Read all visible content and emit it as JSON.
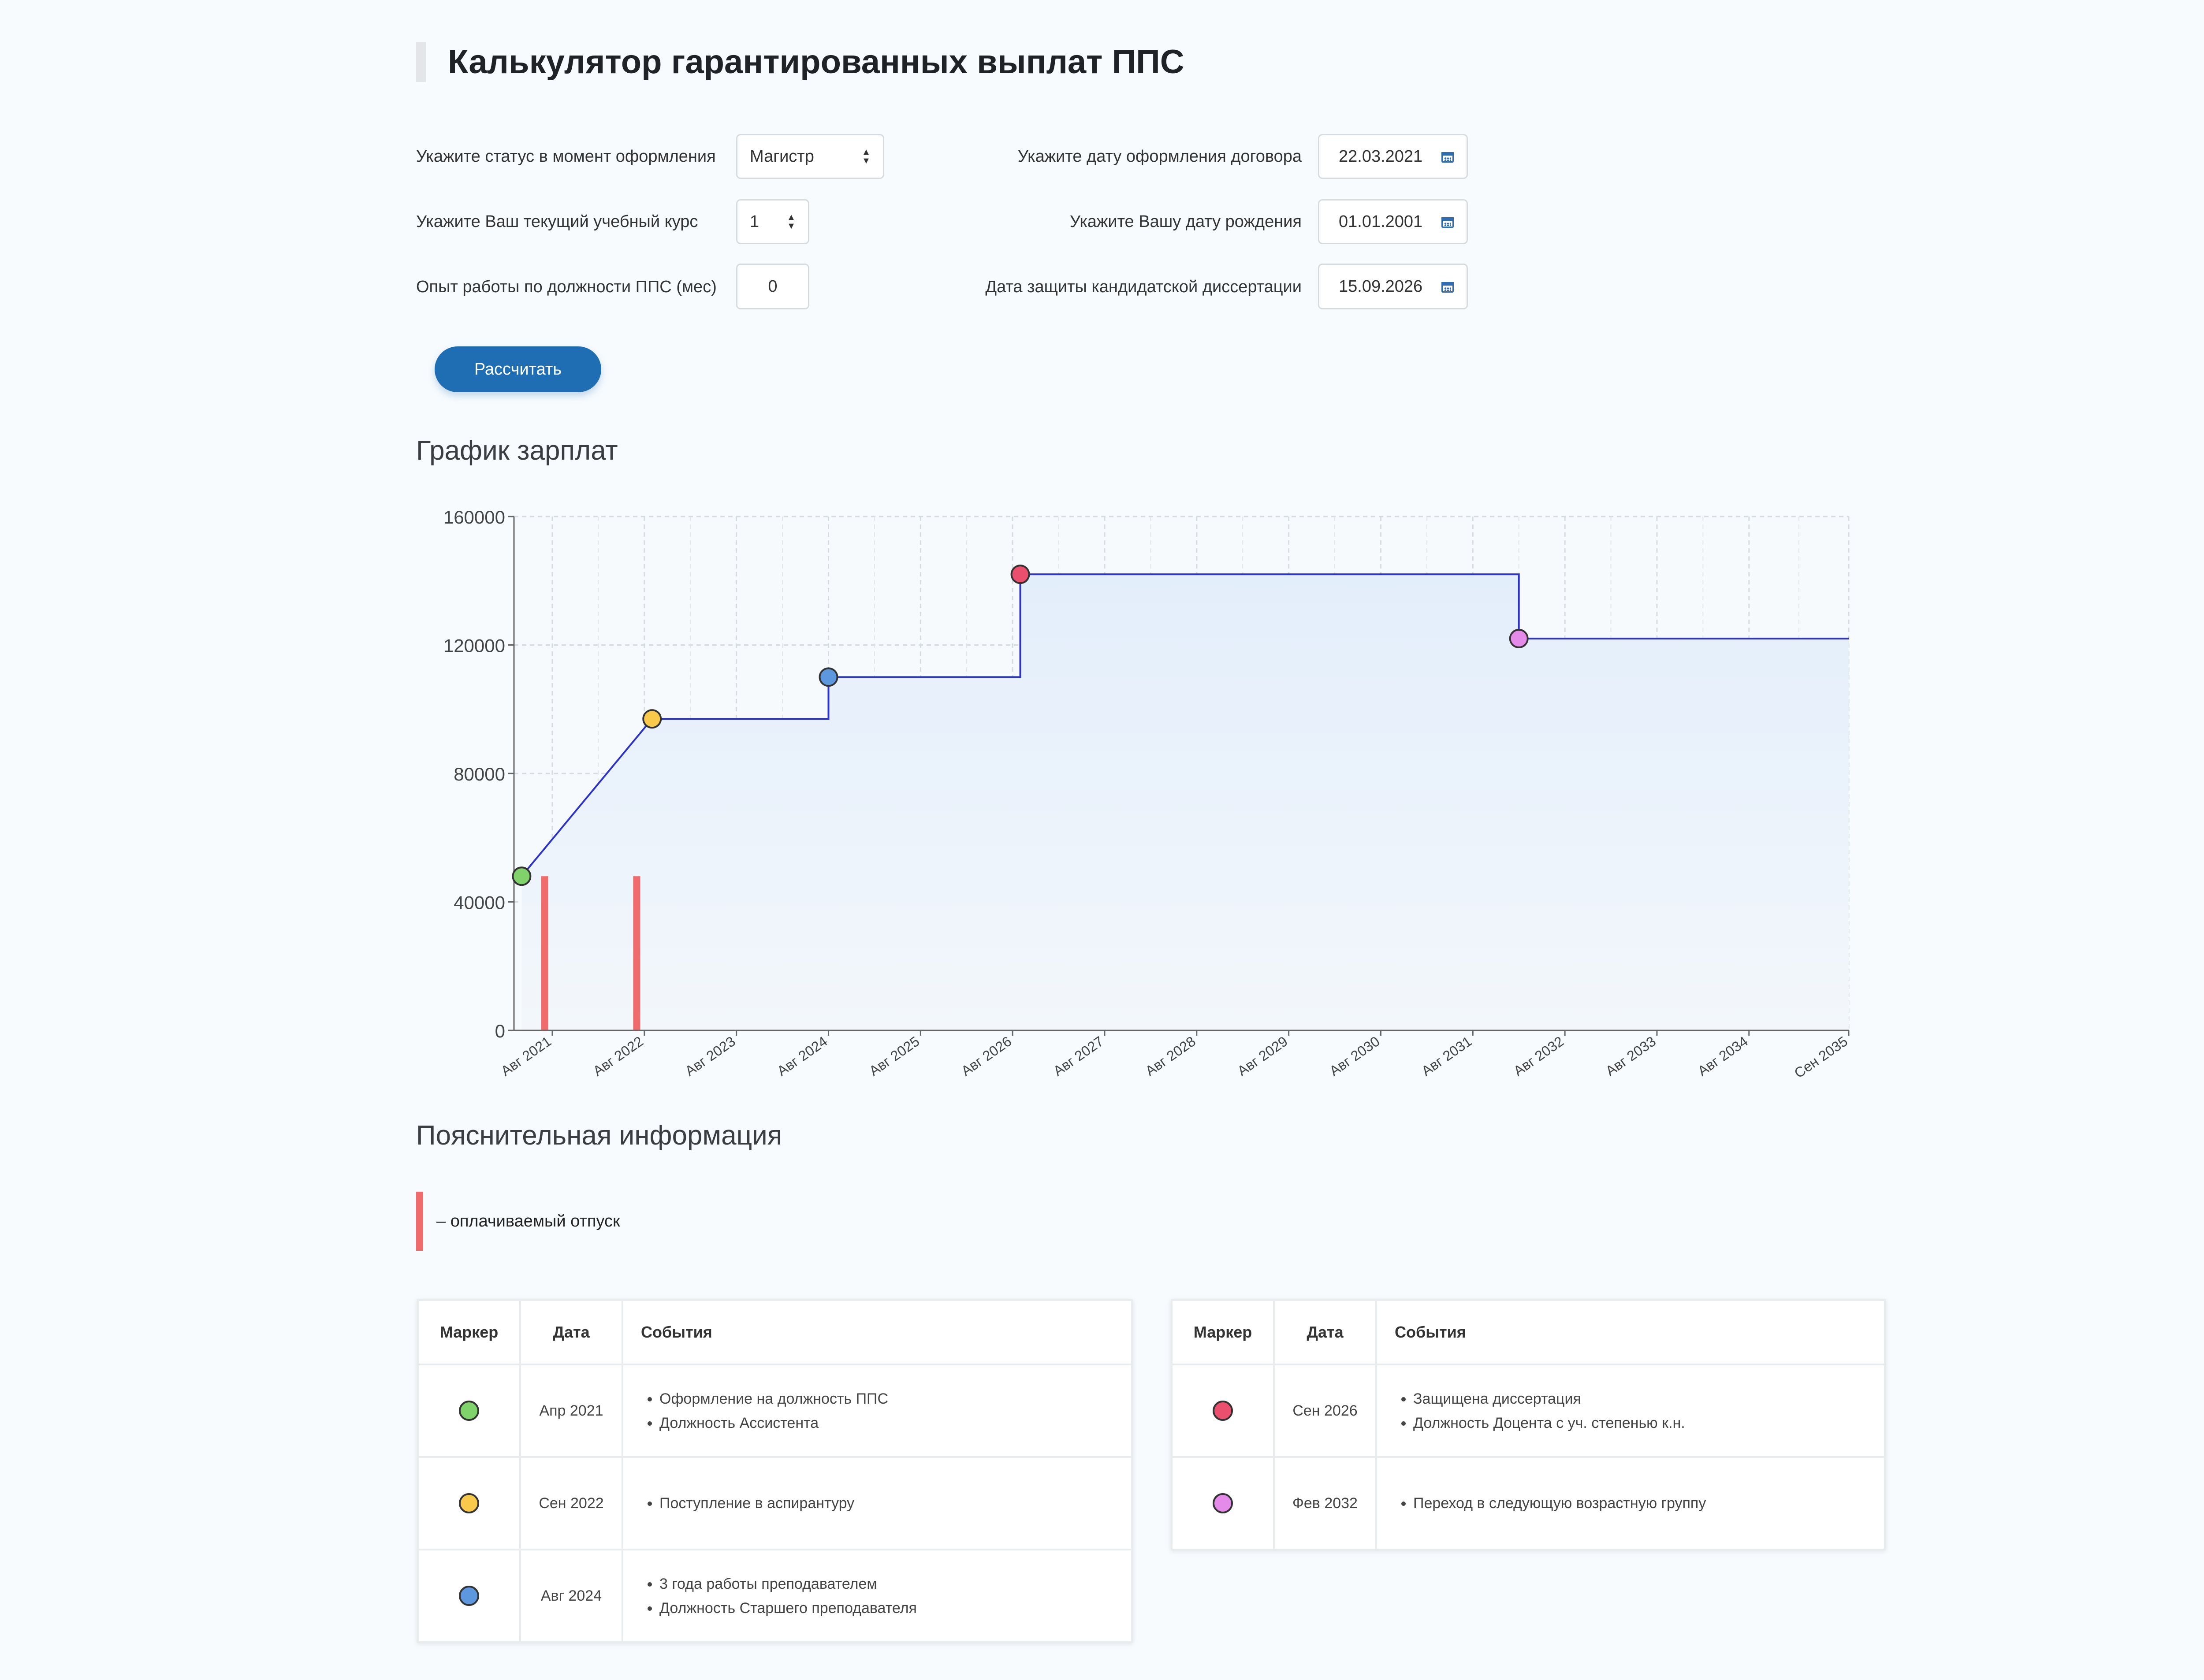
{
  "page": {
    "title": "Калькулятор гарантированных выплат ППС"
  },
  "form": {
    "status_label": "Укажите статус в момент оформления",
    "status_value": "Магистр",
    "course_label": "Укажите Ваш текущий учебный курс",
    "course_value": "1",
    "experience_label": "Опыт работы по должности ППС (мес)",
    "experience_value": "0",
    "contract_date_label": "Укажите дату оформления договора",
    "contract_date_value": "22.03.2021",
    "birth_date_label": "Укажите Вашу дату рождения",
    "birth_date_value": "01.01.2001",
    "defense_date_label": "Дата защиты кандидатской диссертации",
    "defense_date_value": "15.09.2026",
    "calculate_label": "Рассчитать",
    "calendar_icon": "calendar-icon",
    "spinner_icon": "sort-arrows-icon"
  },
  "chart_section_title": "График зарплат",
  "chart_data": {
    "type": "area",
    "title": "",
    "xlabel": "",
    "ylabel": "",
    "ylim": [
      0,
      160000
    ],
    "y_ticks": [
      0,
      40000,
      80000,
      120000,
      160000
    ],
    "x_ticks": [
      "Авг 2021",
      "Авг 2022",
      "Авг 2023",
      "Авг 2024",
      "Авг 2025",
      "Авг 2026",
      "Авг 2027",
      "Авг 2028",
      "Авг 2029",
      "Авг 2030",
      "Авг 2031",
      "Авг 2032",
      "Авг 2033",
      "Авг 2034",
      "Сен 2035"
    ],
    "grid": true,
    "colors": {
      "line": "#2b33c9",
      "area": "#e8f1fc",
      "vacation": "#f06b6b"
    },
    "series": [
      {
        "values": [
          {
            "x": "2021-04",
            "y": 48000
          },
          {
            "x": "2022-09",
            "y": 97000
          },
          {
            "x": "2024-08",
            "y": 97000
          },
          {
            "x": "2024-08",
            "y": 110000
          },
          {
            "x": "2026-09",
            "y": 110000
          },
          {
            "x": "2026-09",
            "y": 142000
          },
          {
            "x": "2032-02",
            "y": 142000
          },
          {
            "x": "2032-02",
            "y": 122000
          },
          {
            "x": "2035-09",
            "y": 122000
          }
        ]
      }
    ],
    "vacations": [
      {
        "x": "2021-07",
        "y": 48000
      },
      {
        "x": "2022-07",
        "y": 48000
      }
    ],
    "markers": [
      {
        "x": "2021-04",
        "y": 48000,
        "color": "#7fd36a"
      },
      {
        "x": "2022-09",
        "y": 97000,
        "color": "#f8c94a"
      },
      {
        "x": "2024-08",
        "y": 110000,
        "color": "#5d97dd"
      },
      {
        "x": "2026-09",
        "y": 142000,
        "color": "#ea4f6e"
      },
      {
        "x": "2032-02",
        "y": 122000,
        "color": "#e48ae8"
      }
    ]
  },
  "info_section_title": "Пояснительная информация",
  "legend": {
    "vacation_text": "– оплачиваемый отпуск"
  },
  "table_headers": {
    "marker": "Маркер",
    "date": "Дата",
    "events": "События"
  },
  "events_left": [
    {
      "color": "#7fd36a",
      "date": "Апр 2021",
      "events": [
        "Оформление на должность ППС",
        "Должность Ассистента"
      ]
    },
    {
      "color": "#f8c94a",
      "date": "Сен 2022",
      "events": [
        "Поступление в аспирантуру"
      ]
    },
    {
      "color": "#5d97dd",
      "date": "Авг 2024",
      "events": [
        "3 года работы преподавателем",
        "Должность Старшего преподавателя"
      ]
    }
  ],
  "events_right": [
    {
      "color": "#ea4f6e",
      "date": "Сен 2026",
      "events": [
        "Защищена диссертация",
        "Должность Доцента с уч. степенью к.н."
      ]
    },
    {
      "color": "#e48ae8",
      "date": "Фев 2032",
      "events": [
        "Переход в следующую возрастную группу"
      ]
    }
  ]
}
